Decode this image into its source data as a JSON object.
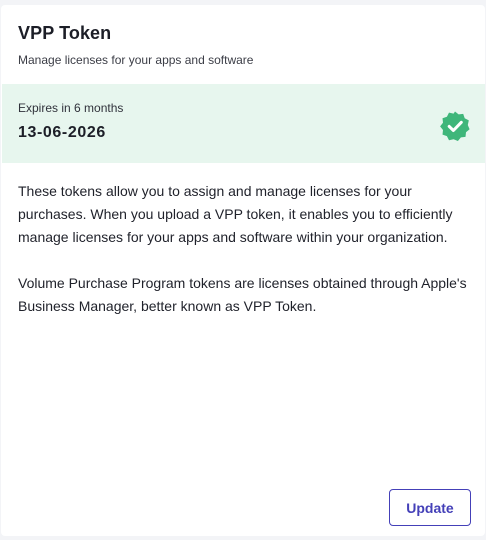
{
  "header": {
    "title": "VPP Token",
    "subtitle": "Manage licenses for your apps and software"
  },
  "expiry": {
    "label": "Expires in 6 months",
    "date": "13-06-2026",
    "status_icon": "verified-badge-icon",
    "status_color": "#3fb67a",
    "background_color": "#e7f6ee"
  },
  "description": {
    "paragraph_1": "These tokens allow you to assign and manage licenses for your purchases. When you upload a VPP token, it enables you to efficiently manage licenses for your apps and software within your organization.",
    "paragraph_2": "Volume Purchase Program tokens are licenses obtained through Apple's Business Manager, better known as VPP Token."
  },
  "actions": {
    "update_label": "Update",
    "accent_color": "#4440b8"
  }
}
